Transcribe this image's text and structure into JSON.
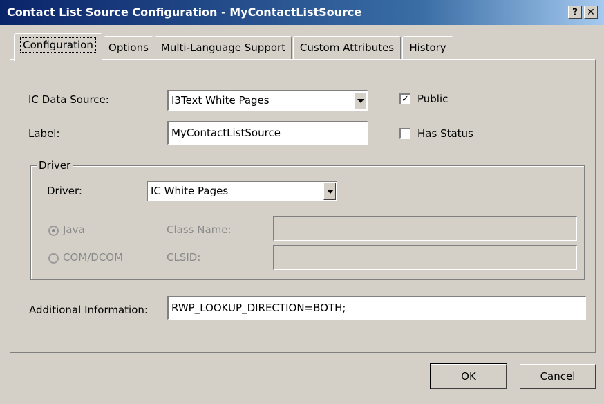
{
  "window": {
    "title": "Contact List Source Configuration - MyContactListSource",
    "help_label": "?",
    "close_label": "✕"
  },
  "tabs": [
    {
      "label": "Configuration",
      "active": true
    },
    {
      "label": "Options"
    },
    {
      "label": "Multi-Language Support"
    },
    {
      "label": "Custom Attributes"
    },
    {
      "label": "History"
    }
  ],
  "config": {
    "ic_data_source_label": "IC Data Source:",
    "ic_data_source_value": "I3Text White Pages",
    "label_label": "Label:",
    "label_value": "MyContactListSource",
    "public_label": "Public",
    "public_checked": true,
    "has_status_label": "Has Status",
    "has_status_checked": false,
    "driver_group_title": "Driver",
    "driver_label": "Driver:",
    "driver_value": "IC White Pages",
    "java_label": "Java",
    "com_label": "COM/DCOM",
    "class_name_label": "Class Name:",
    "class_name_value": "",
    "clsid_label": "CLSID:",
    "clsid_value": "",
    "additional_info_label": "Additional Information:",
    "additional_info_value": "RWP_LOOKUP_DIRECTION=BOTH;"
  },
  "buttons": {
    "ok": "OK",
    "cancel": "Cancel"
  },
  "check_mark": "✓"
}
